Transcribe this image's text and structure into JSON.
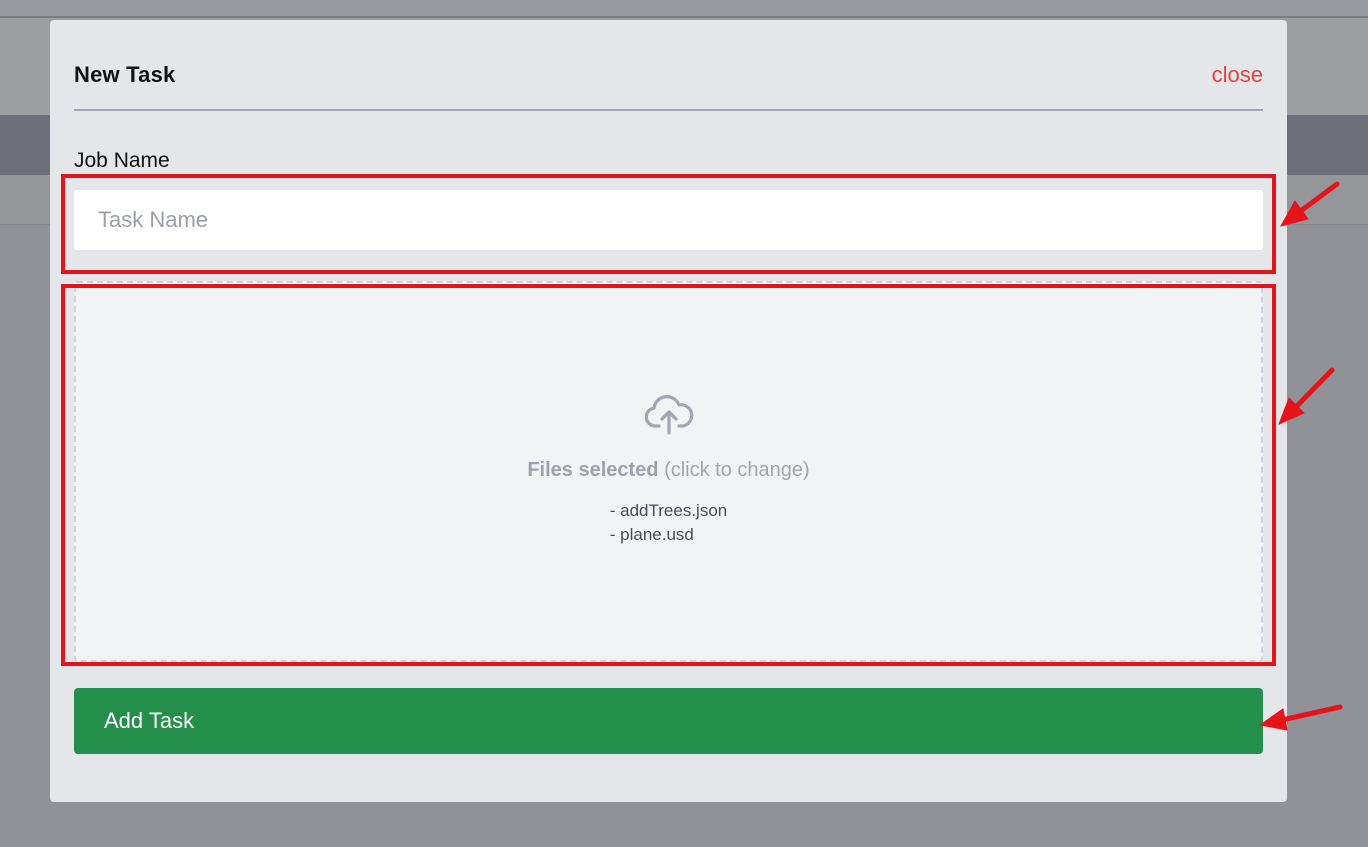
{
  "modal": {
    "title": "New Task",
    "close_label": "close"
  },
  "form": {
    "job_name_label": "Job Name",
    "task_name_placeholder": "Task Name",
    "task_name_value": ""
  },
  "dropzone": {
    "icon": "cloud-upload-icon",
    "selected_label": "Files selected",
    "hint": "(click to change)",
    "files": [
      "- addTrees.json",
      "- plane.usd"
    ]
  },
  "submit": {
    "label": "Add Task"
  },
  "colors": {
    "accent_green": "#248f4a",
    "close_red": "#e8403a",
    "annotation_red": "#e5141b"
  }
}
